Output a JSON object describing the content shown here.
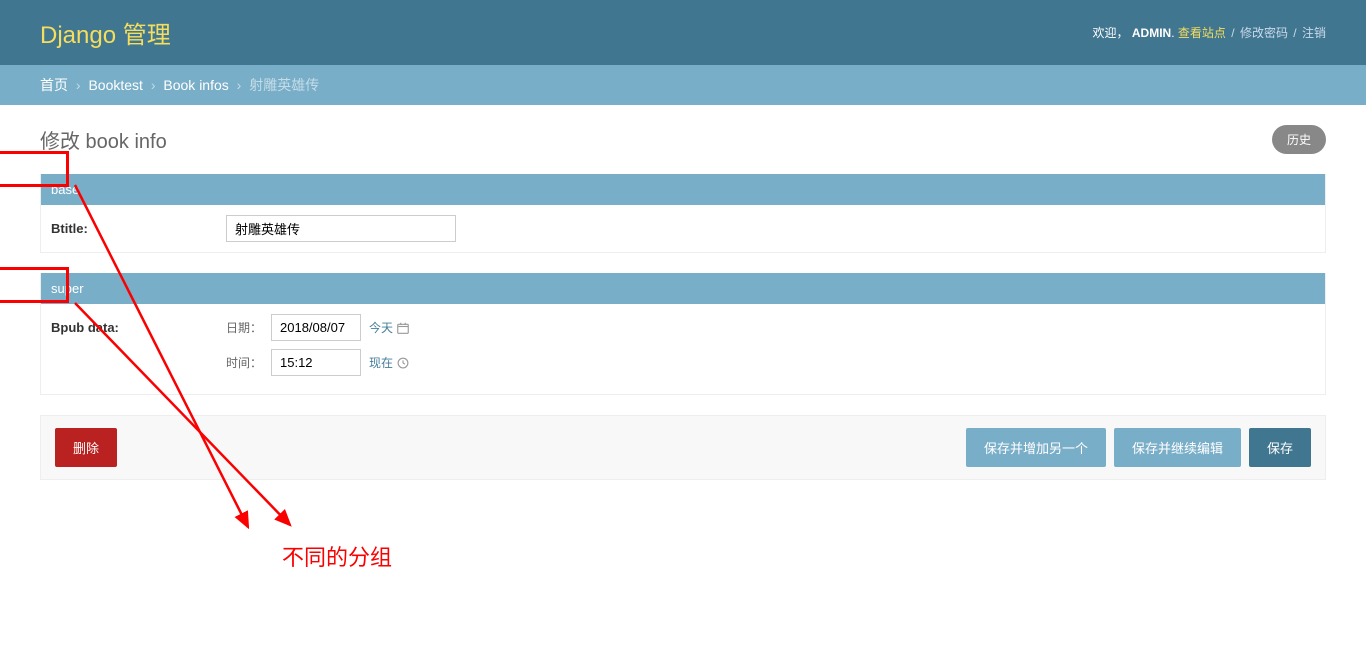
{
  "header": {
    "branding": "Django 管理",
    "welcome_prefix": "欢迎，",
    "user": "ADMIN",
    "view_site": "查看站点",
    "change_password": "修改密码",
    "logout": "注销"
  },
  "breadcrumbs": {
    "home": "首页",
    "app": "Booktest",
    "model": "Book infos",
    "current": "射雕英雄传"
  },
  "page": {
    "title": "修改 book info",
    "history": "历史"
  },
  "fieldsets": [
    {
      "name": "base",
      "fields": [
        {
          "label": "Btitle:",
          "type": "text",
          "value": "射雕英雄传",
          "id": "btitle"
        }
      ]
    },
    {
      "name": "super",
      "fields": [
        {
          "label": "Bpub data:",
          "type": "datetime",
          "id": "bpub_data",
          "date_label": "日期：",
          "date_value": "2018/08/07",
          "date_shortcut": "今天",
          "time_label": "时间：",
          "time_value": "15:12",
          "time_shortcut": "现在"
        }
      ]
    }
  ],
  "actions": {
    "delete": "删除",
    "save_add": "保存并增加另一个",
    "save_continue": "保存并继续编辑",
    "save": "保存"
  },
  "annotation": {
    "label": "不同的分组"
  }
}
